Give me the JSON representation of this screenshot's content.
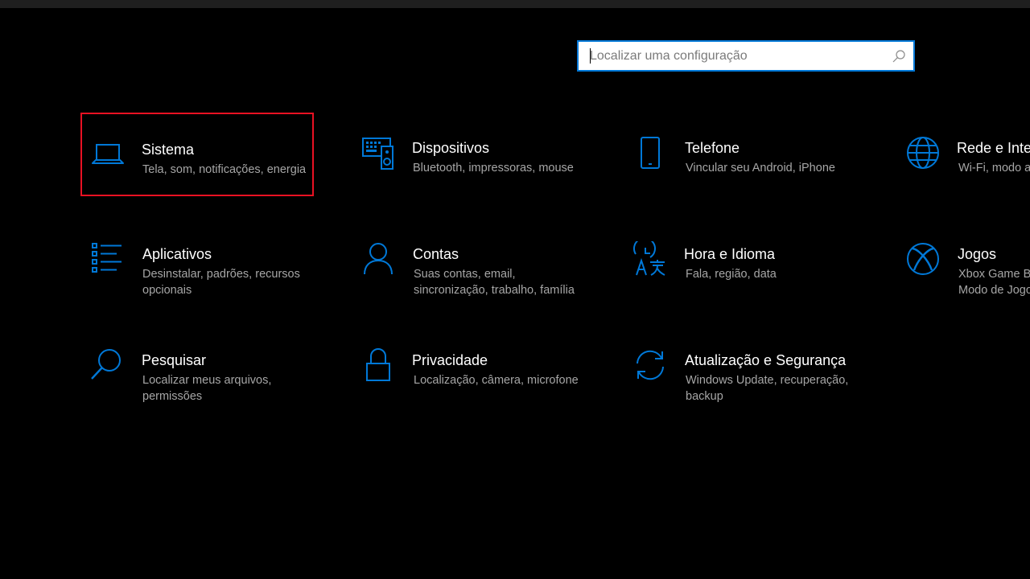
{
  "search": {
    "placeholder": "Localizar uma configuração"
  },
  "accent_color": "#0078d7",
  "highlight_color": "#e81123",
  "tiles": [
    {
      "title": "Sistema",
      "description": "Tela, som, notificações, energia",
      "icon": "laptop-icon"
    },
    {
      "title": "Dispositivos",
      "description": "Bluetooth, impressoras, mouse",
      "icon": "keyboard-speaker-icon"
    },
    {
      "title": "Telefone",
      "description": "Vincular seu Android, iPhone",
      "icon": "phone-icon"
    },
    {
      "title": "Rede e Inter",
      "description": "Wi-Fi, modo a",
      "icon": "globe-icon"
    },
    {
      "title": "Aplicativos",
      "description": "Desinstalar, padrões, recursos opcionais",
      "icon": "apps-list-icon"
    },
    {
      "title": "Contas",
      "description": "Suas contas, email, sincronização, trabalho, família",
      "icon": "person-icon"
    },
    {
      "title": "Hora e Idioma",
      "description": "Fala, região, data",
      "icon": "time-language-icon"
    },
    {
      "title": "Jogos",
      "description": "Xbox Game B Modo de Jogo",
      "icon": "xbox-icon"
    },
    {
      "title": "Pesquisar",
      "description": "Localizar meus arquivos, permissões",
      "icon": "search-icon"
    },
    {
      "title": "Privacidade",
      "description": "Localização, câmera, microfone",
      "icon": "lock-icon"
    },
    {
      "title": "Atualização e Segurança",
      "description": "Windows Update, recuperação, backup",
      "icon": "sync-icon"
    }
  ]
}
